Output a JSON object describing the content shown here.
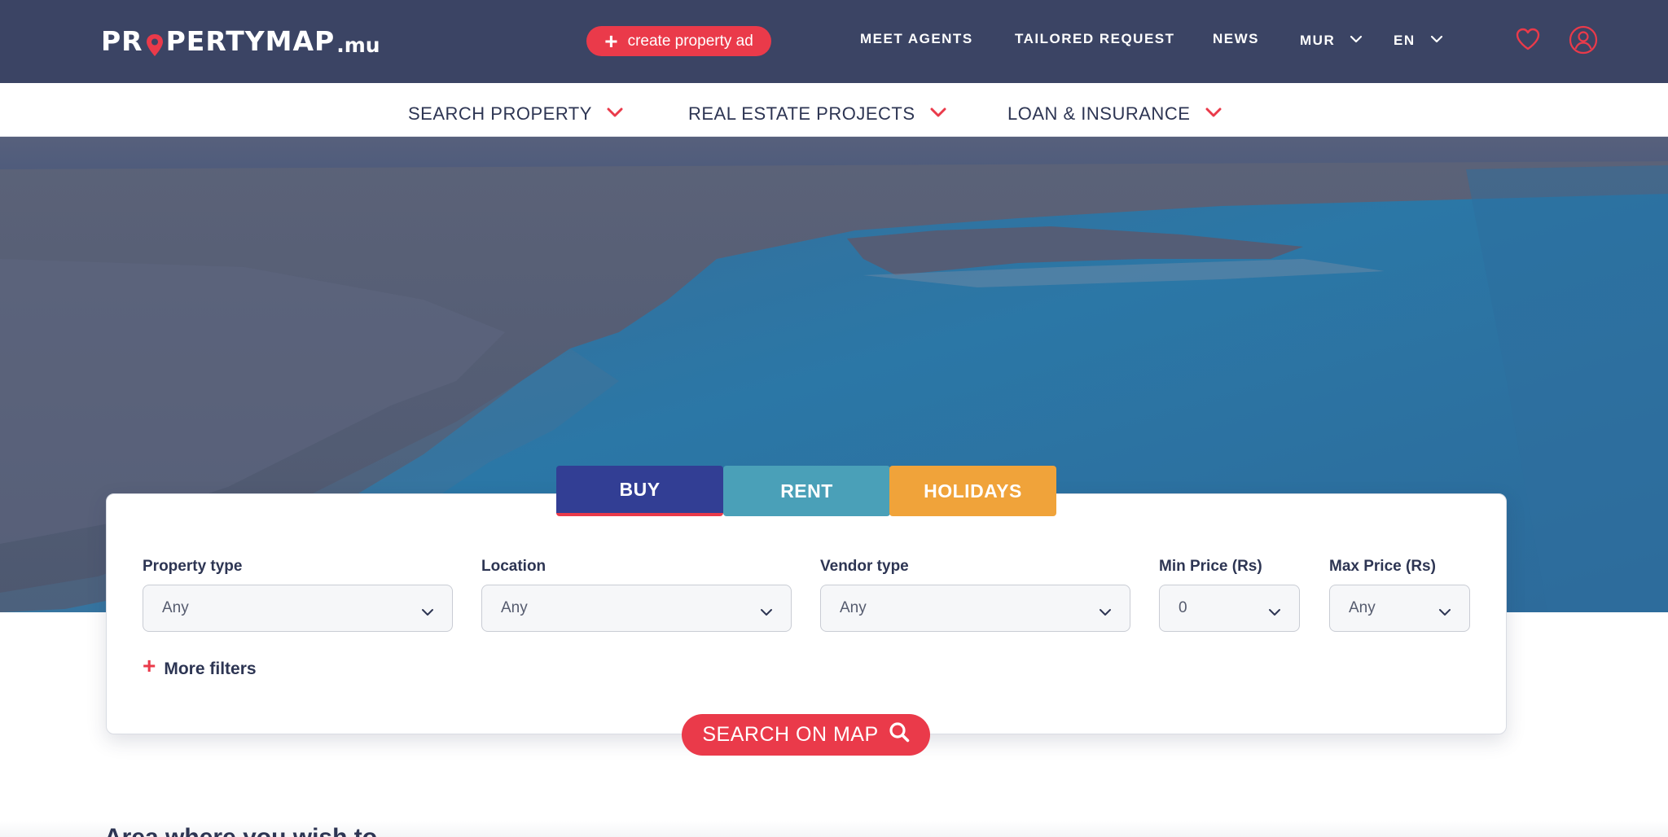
{
  "header": {
    "logo_text_start": "PR",
    "logo_text_end": "PERTYMAP",
    "logo_suffix": ".mu",
    "create_ad_label": "create property ad",
    "nav": [
      {
        "label": "MEET AGENTS"
      },
      {
        "label": "TAILORED REQUEST"
      },
      {
        "label": "NEWS"
      },
      {
        "label": "MUR"
      },
      {
        "label": "EN"
      }
    ],
    "icons": {
      "favorites": "heart-icon",
      "account": "user-icon"
    },
    "bg_color": "#3b4464"
  },
  "subnav": {
    "items": [
      {
        "label": "SEARCH PROPERTY"
      },
      {
        "label": "REAL ESTATE PROJECTS"
      },
      {
        "label": "LOAN & INSURANCE"
      }
    ]
  },
  "tabs": [
    {
      "label": "BUY",
      "active": true,
      "color": "#323e94"
    },
    {
      "label": "RENT",
      "active": false,
      "color": "#4aa0b8"
    },
    {
      "label": "HOLIDAYS",
      "active": false,
      "color": "#f0a33a"
    }
  ],
  "filters": [
    {
      "label": "Property type",
      "value": "Any"
    },
    {
      "label": "Location",
      "value": "Any"
    },
    {
      "label": "Vendor type",
      "value": "Any"
    },
    {
      "label": "Min Price (Rs)",
      "value": "0"
    },
    {
      "label": "Max Price (Rs)",
      "value": "Any"
    }
  ],
  "more_filters_label": "More filters",
  "search_button_label": "SEARCH ON MAP",
  "section_heading_partial": "Area where you wish to live",
  "accent_color": "#ea3a4a"
}
